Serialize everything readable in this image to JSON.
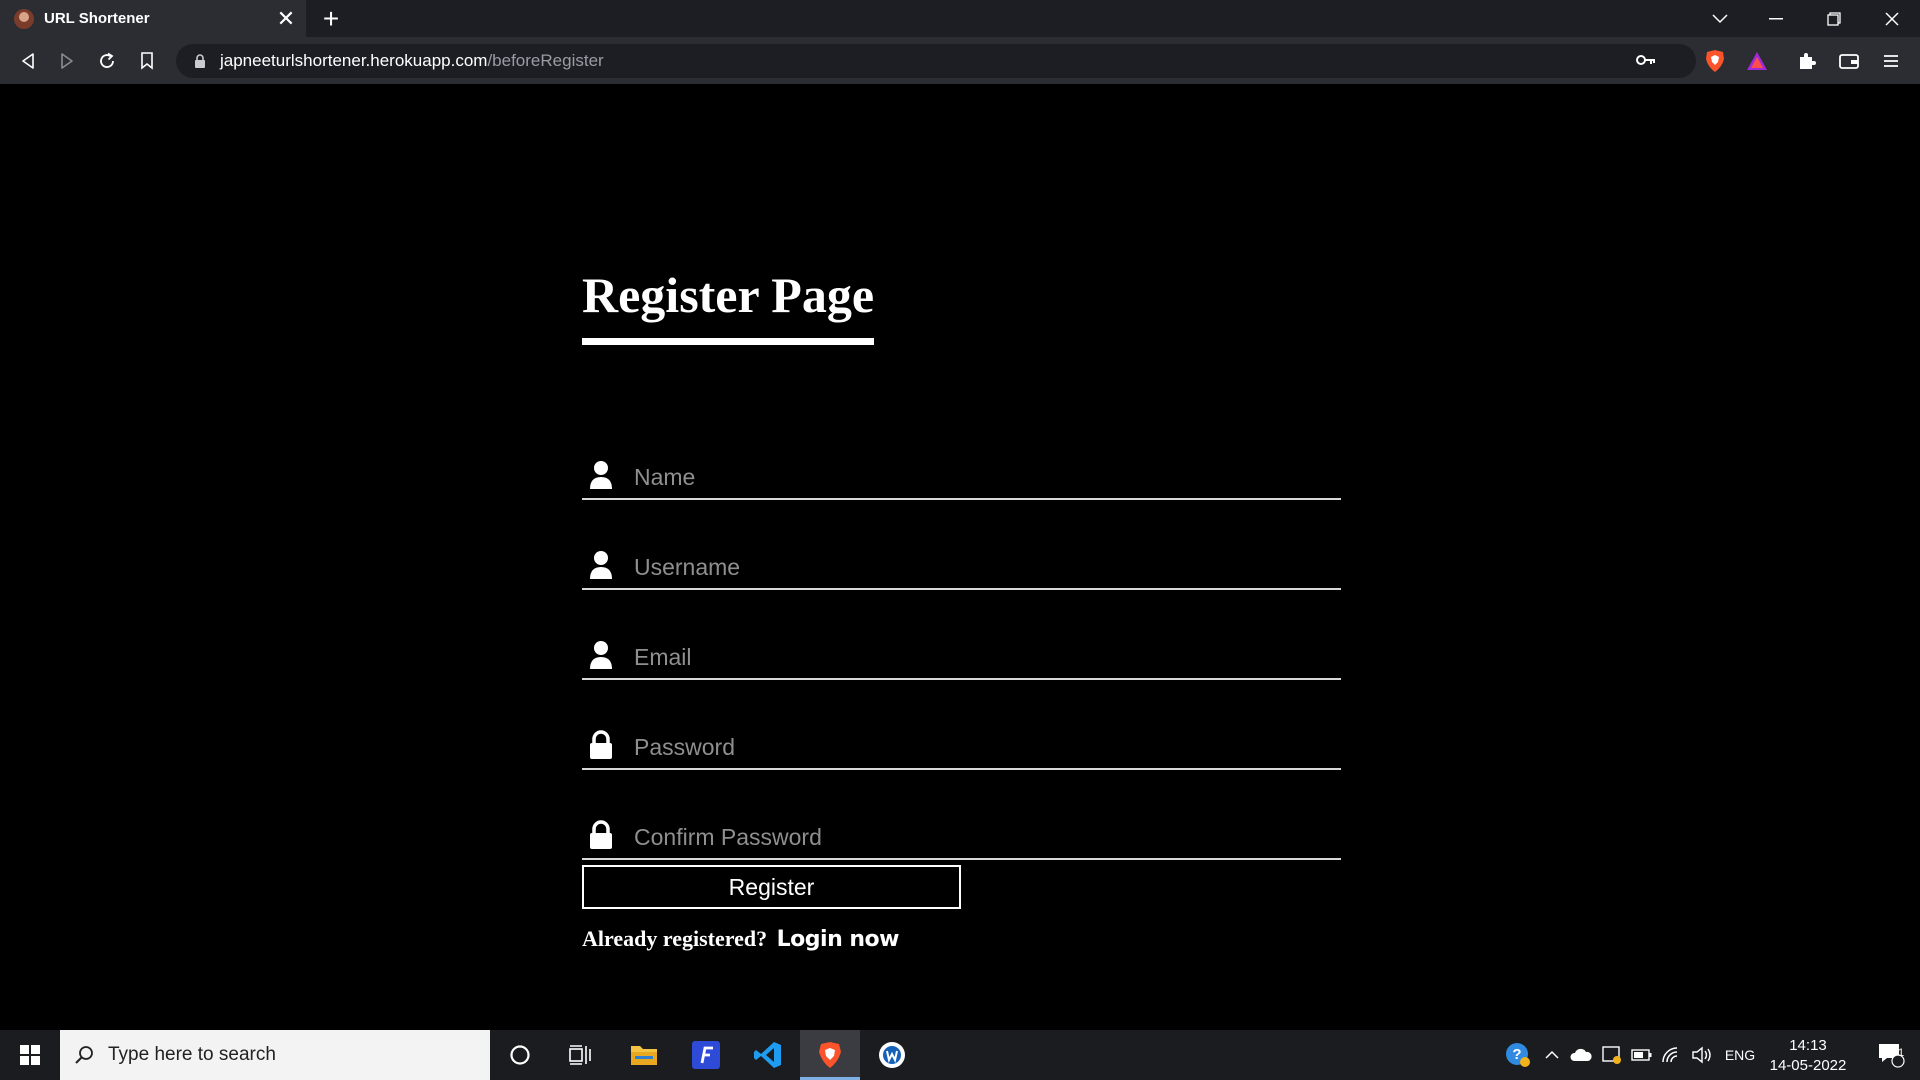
{
  "browser": {
    "tab_title": "URL Shortener",
    "url_host": "japneeturlshortener.herokuapp.com",
    "url_path": "/beforeRegister"
  },
  "page": {
    "title": "Register Page",
    "fields": {
      "name": {
        "placeholder": "Name",
        "icon": "user-icon"
      },
      "username": {
        "placeholder": "Username",
        "icon": "user-icon"
      },
      "email": {
        "placeholder": "Email",
        "icon": "user-icon"
      },
      "password": {
        "placeholder": "Password",
        "icon": "lock-icon"
      },
      "confirm_password": {
        "placeholder": "Confirm Password",
        "icon": "lock-icon"
      }
    },
    "register_label": "Register",
    "already_text": "Already registered?",
    "login_link": "Login now"
  },
  "taskbar": {
    "search_placeholder": "Type here to search",
    "lang": "ENG",
    "time": "14:13",
    "date": "14-05-2022",
    "notification_count": "1"
  },
  "colors": {
    "page_bg": "#000000",
    "chrome_bg": "#2b2d33",
    "tabstrip_bg": "#1c1e24",
    "brave_orange": "#fb542b"
  }
}
